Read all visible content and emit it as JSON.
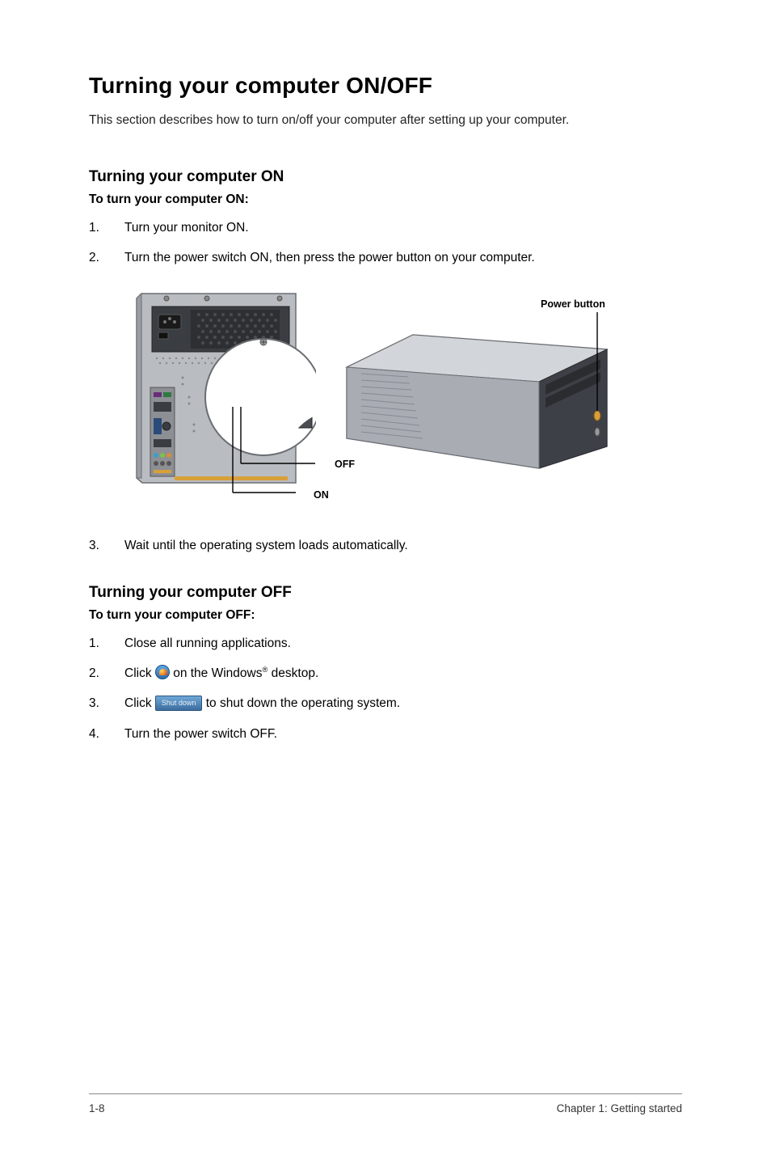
{
  "title": "Turning your computer ON/OFF",
  "intro": "This section describes how to turn on/off your computer after setting up your computer.",
  "on": {
    "heading": "Turning your computer ON",
    "sub": "To turn your computer ON:",
    "steps": {
      "s1": "Turn your monitor ON.",
      "s2": "Turn the power switch ON, then press the power button on your computer.",
      "s3": "Wait until the operating system loads automatically."
    }
  },
  "diagram": {
    "off_label": "OFF",
    "on_label": "ON",
    "power_button_label": "Power button"
  },
  "off": {
    "heading": "Turning your computer OFF",
    "sub": "To turn your computer OFF:",
    "steps": {
      "s1": "Close all running applications.",
      "s2_pre": "Click ",
      "s2_post_a": " on the Windows",
      "s2_post_b": " desktop.",
      "s3_pre": "Click ",
      "s3_btn": "Shut down",
      "s3_post": " to shut down the operating system.",
      "s4": "Turn the power switch OFF."
    }
  },
  "footer": {
    "left": "1-8",
    "right": "Chapter 1: Getting started"
  }
}
